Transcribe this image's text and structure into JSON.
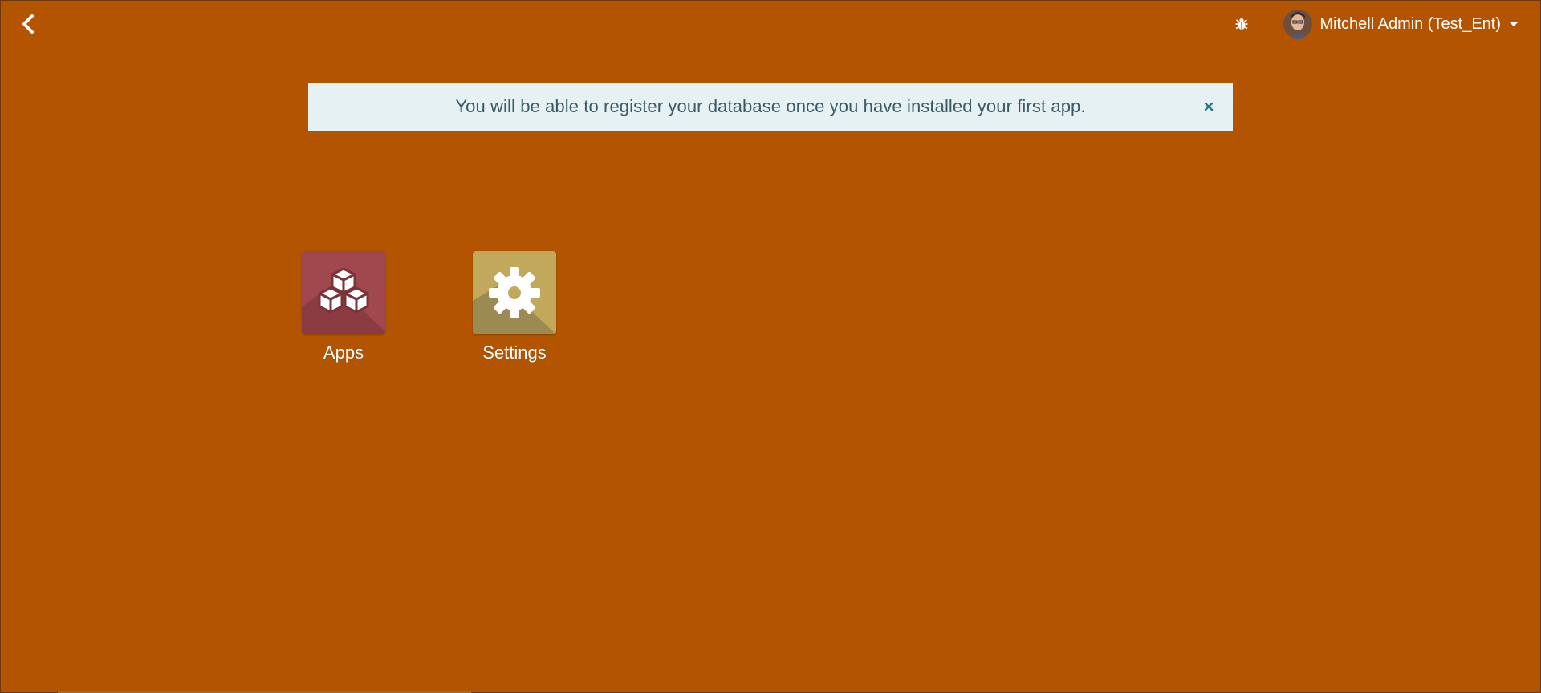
{
  "topbar": {
    "back_icon": "chevron-left-icon",
    "debug_icon": "bug-icon",
    "user_name": "Mitchell Admin (Test_Ent)"
  },
  "alert": {
    "message": "You will be able to register your database once you have installed your first app.",
    "close_label": "×"
  },
  "apps": [
    {
      "label": "Apps",
      "icon": "cubes-icon",
      "color": "#a0484e"
    },
    {
      "label": "Settings",
      "icon": "gear-icon",
      "color": "#c2a85a"
    }
  ],
  "colors": {
    "background": "#b35500",
    "alert_bg": "#e6f1f4",
    "alert_text": "#3a5a66"
  }
}
